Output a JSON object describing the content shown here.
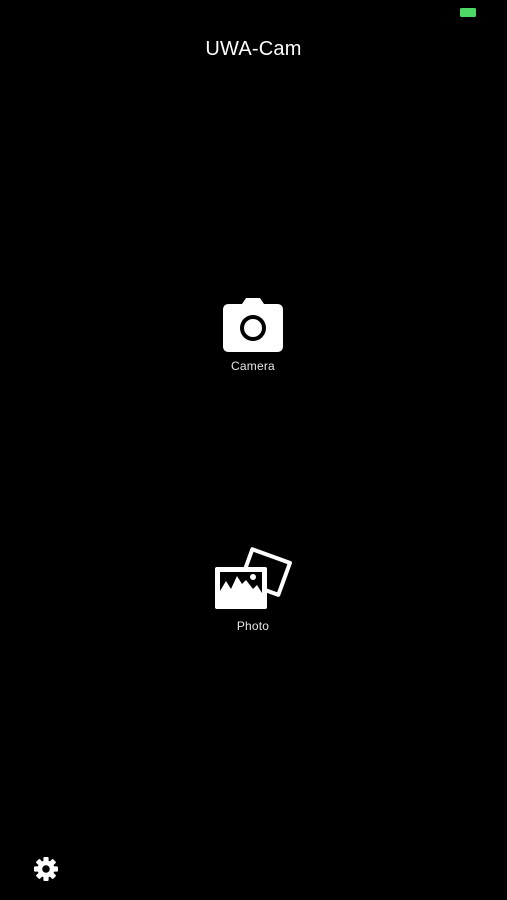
{
  "status_bar": {
    "battery_color": "#4cd964"
  },
  "header": {
    "title": "UWA-Cam"
  },
  "actions": {
    "camera": {
      "label": "Camera",
      "icon": "camera-icon"
    },
    "photo": {
      "label": "Photo",
      "icon": "photos-icon"
    }
  },
  "footer": {
    "settings_icon": "gear-icon"
  },
  "colors": {
    "background": "#000000",
    "foreground": "#ffffff"
  }
}
